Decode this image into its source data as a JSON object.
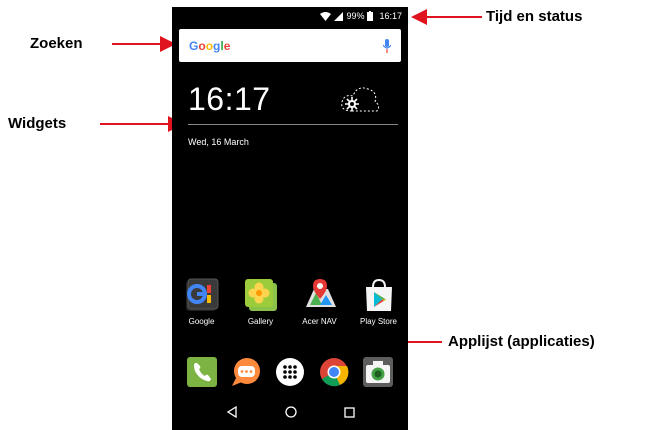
{
  "callouts": {
    "time_status": "Tijd en status",
    "search": "Zoeken",
    "widgets": "Widgets",
    "app_list": "Applijst (applicaties)"
  },
  "status_bar": {
    "battery": "99%",
    "time": "16:17",
    "icons": [
      "wifi-icon",
      "signal-icon",
      "battery-icon"
    ]
  },
  "search_bar": {
    "logo": "Google",
    "icon": "mic-icon"
  },
  "clock_widget": {
    "time": "16:17",
    "date": "Wed, 16 March",
    "icon": "weather-icon"
  },
  "apps": [
    {
      "label": "Google",
      "icon": "google-icon"
    },
    {
      "label": "Gallery",
      "icon": "gallery-icon"
    },
    {
      "label": "Acer NAV",
      "icon": "acer-nav-icon"
    },
    {
      "label": "Play Store",
      "icon": "play-store-icon"
    }
  ],
  "dock": [
    "phone-icon",
    "messaging-icon",
    "app-drawer-icon",
    "chrome-icon",
    "camera-icon"
  ],
  "navigation": [
    "back-icon",
    "home-icon",
    "recents-icon"
  ],
  "colors": {
    "arrow": "#e0141e",
    "screen": "#000000"
  }
}
